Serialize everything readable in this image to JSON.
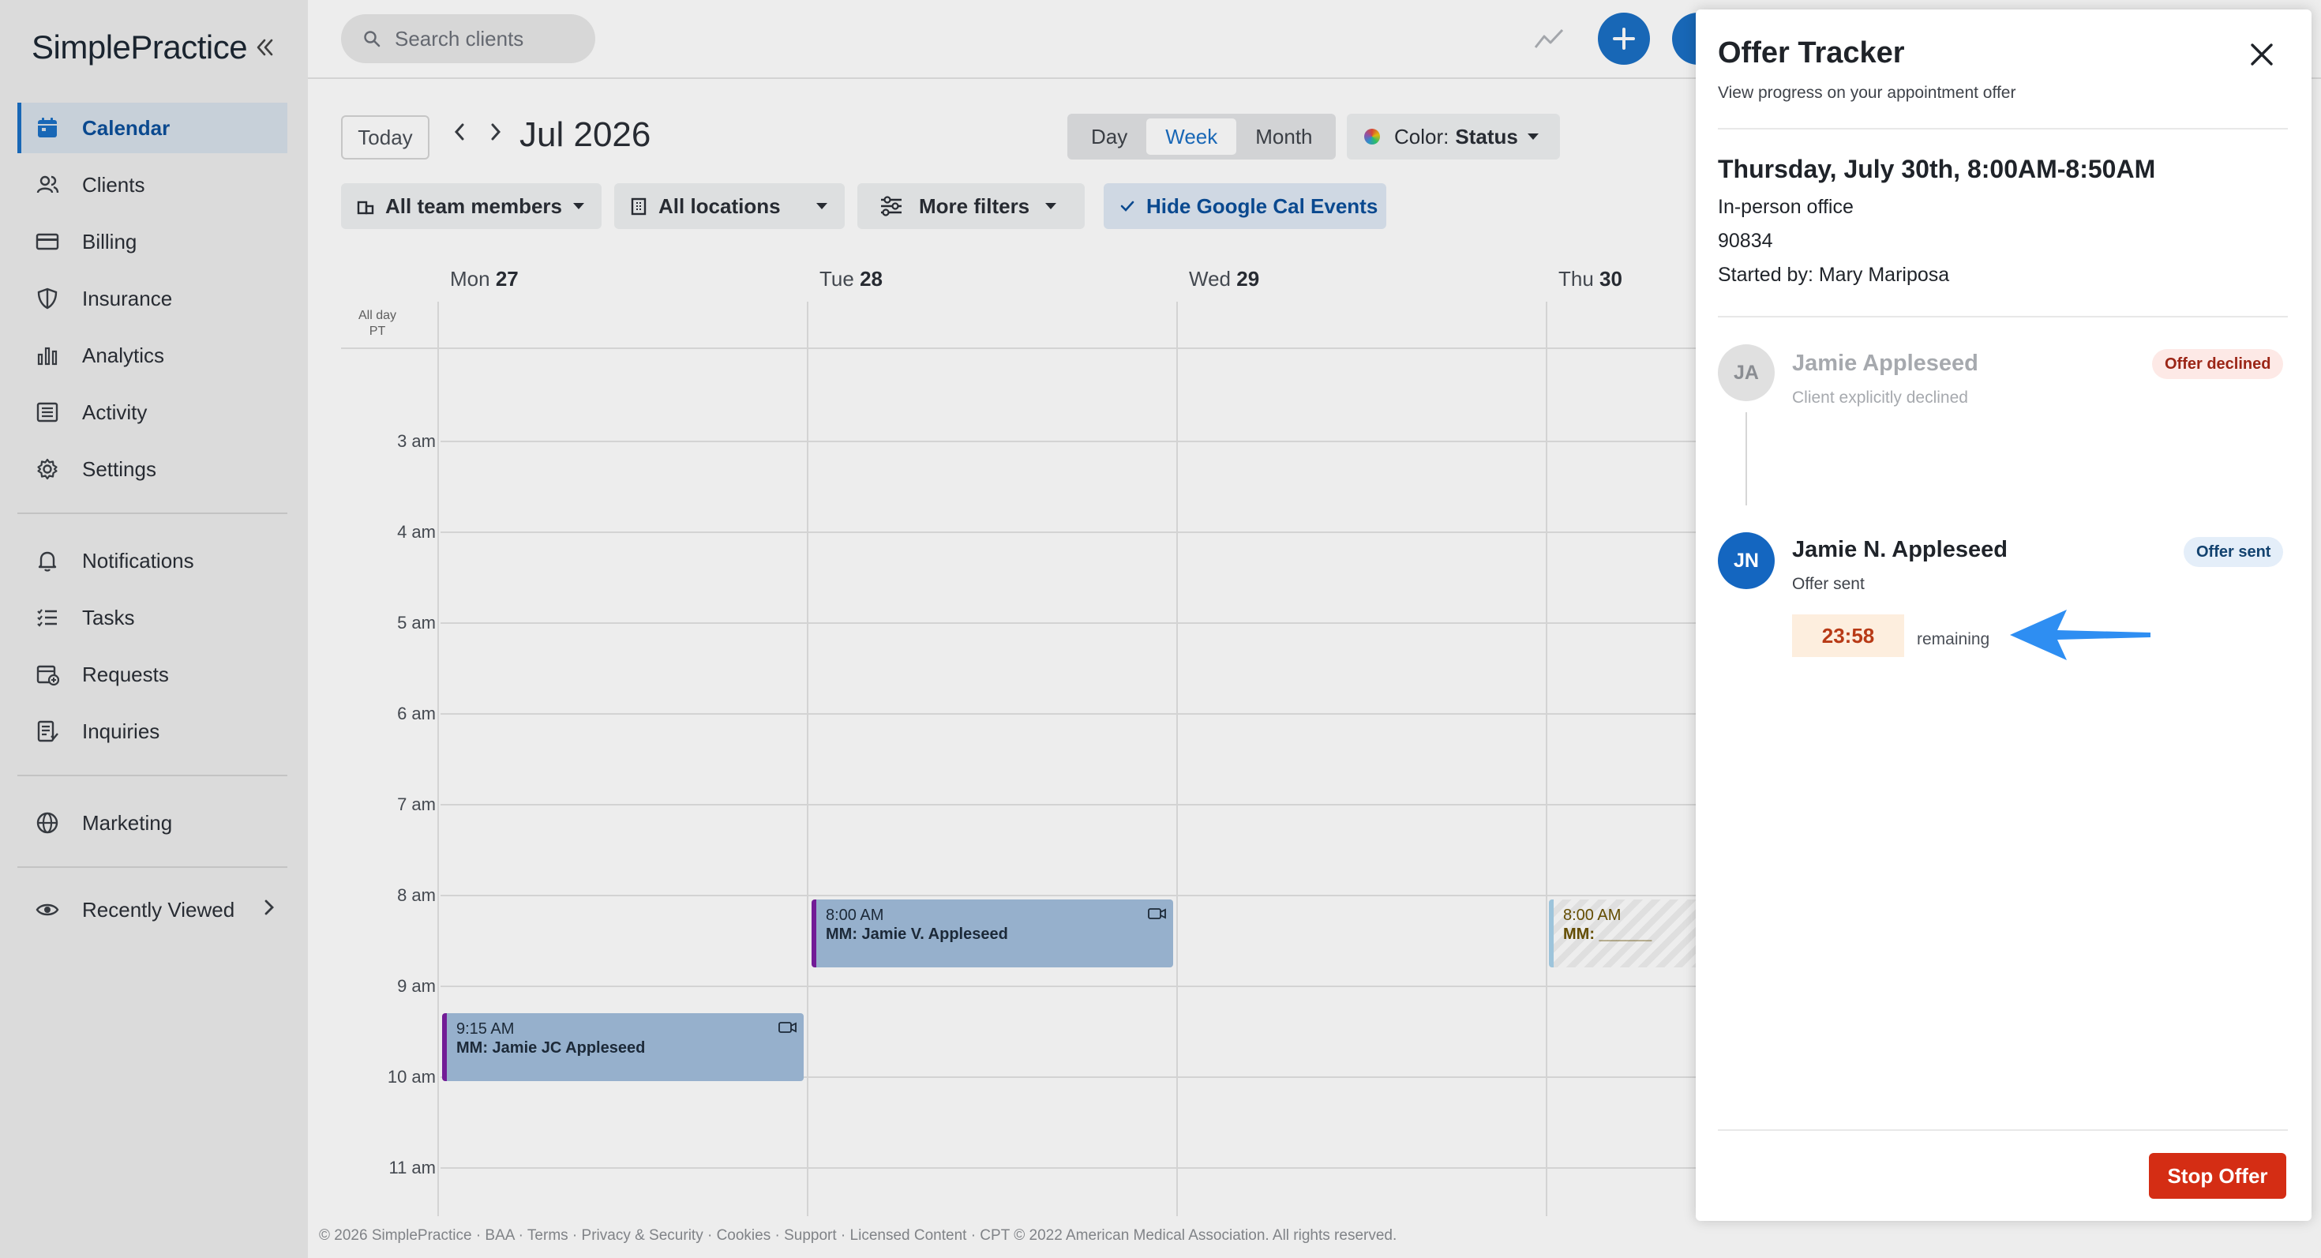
{
  "sidebar": {
    "logo": "SimplePractice",
    "items": [
      {
        "label": "Calendar",
        "icon": "calendar-icon"
      },
      {
        "label": "Clients",
        "icon": "users-icon"
      },
      {
        "label": "Billing",
        "icon": "credit-card-icon"
      },
      {
        "label": "Insurance",
        "icon": "shield-icon"
      },
      {
        "label": "Analytics",
        "icon": "bar-chart-icon"
      },
      {
        "label": "Activity",
        "icon": "list-icon"
      },
      {
        "label": "Settings",
        "icon": "gear-icon"
      },
      {
        "label": "Notifications",
        "icon": "bell-icon"
      },
      {
        "label": "Tasks",
        "icon": "checklist-icon"
      },
      {
        "label": "Requests",
        "icon": "calendar-plus-icon"
      },
      {
        "label": "Inquiries",
        "icon": "inquiry-icon"
      },
      {
        "label": "Marketing",
        "icon": "globe-icon"
      },
      {
        "label": "Recently Viewed",
        "icon": "eye-icon"
      }
    ]
  },
  "header": {
    "search_placeholder": "Search clients"
  },
  "toolbar": {
    "today": "Today",
    "month_label": "Jul 2026",
    "views": [
      "Day",
      "Week",
      "Month"
    ],
    "selected_view": "Week",
    "color_label": "Color:",
    "color_value": "Status"
  },
  "filters": {
    "team": "All team members",
    "locations": "All locations",
    "more": "More filters",
    "google": "Hide Google Cal Events"
  },
  "calendar": {
    "days": [
      {
        "name": "Mon",
        "num": "27"
      },
      {
        "name": "Tue",
        "num": "28"
      },
      {
        "name": "Wed",
        "num": "29"
      },
      {
        "name": "Thu",
        "num": "30"
      }
    ],
    "allday_label": "All day",
    "tz_label": "PT",
    "hours": [
      "3 am",
      "4 am",
      "5 am",
      "6 am",
      "7 am",
      "8 am",
      "9 am",
      "10 am",
      "11 am"
    ],
    "events": [
      {
        "time": "8:00 AM",
        "title": "MM: Jamie V. Appleseed"
      },
      {
        "time": "9:15 AM",
        "title": "MM: Jamie JC Appleseed"
      },
      {
        "time": "8:00 AM",
        "title": "MM: ______"
      }
    ]
  },
  "footer": "© 2026 SimplePractice · BAA · Terms · Privacy & Security · Cookies · Support · Licensed Content · CPT © 2022 American Medical Association. All rights reserved.",
  "panel": {
    "title": "Offer Tracker",
    "subtitle": "View progress on your appointment offer",
    "when": "Thursday, July 30th, 8:00AM-8:50AM",
    "location": "In-person office",
    "code": "90834",
    "started_by": "Started by: Mary Mariposa",
    "offers": [
      {
        "initials": "JA",
        "name": "Jamie Appleseed",
        "note": "Client explicitly declined",
        "badge": "Offer declined"
      },
      {
        "initials": "JN",
        "name": "Jamie N. Appleseed",
        "note": "Offer sent",
        "badge": "Offer sent"
      }
    ],
    "timer": "23:58",
    "remaining": "remaining",
    "stop_button": "Stop Offer"
  },
  "colors": {
    "accent": "#1a6fc4",
    "danger": "#d42d14",
    "event_bg": "#a2bedc"
  }
}
